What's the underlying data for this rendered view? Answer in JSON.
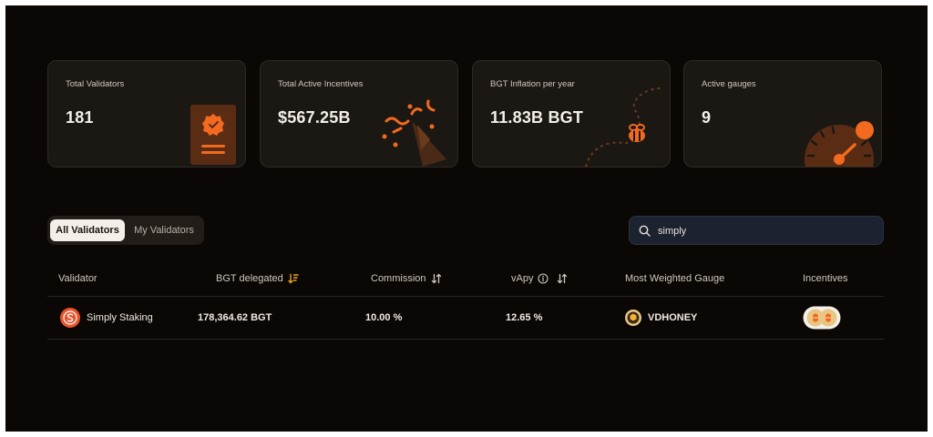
{
  "stats": [
    {
      "label": "Total Validators",
      "value": "181",
      "icon": "validator-badge-icon"
    },
    {
      "label": "Total Active Incentives",
      "value": "$567.25B",
      "icon": "confetti-icon"
    },
    {
      "label": "BGT Inflation per year",
      "value": "11.83B BGT",
      "icon": "bee-icon"
    },
    {
      "label": "Active gauges",
      "value": "9",
      "icon": "gauge-icon"
    }
  ],
  "tabs": {
    "all": "All Validators",
    "mine": "My Validators",
    "active": "All Validators"
  },
  "search": {
    "value": "simply",
    "icon": "search-icon"
  },
  "table": {
    "headers": {
      "validator": "Validator",
      "bgt_delegated": "BGT delegated",
      "commission": "Commission",
      "vapy": "vApy",
      "gauge": "Most Weighted Gauge",
      "incentives": "Incentives"
    },
    "rows": [
      {
        "validator": "Simply Staking",
        "bgt_delegated": "178,364.62 BGT",
        "commission": "10.00 %",
        "vapy": "12.65 %",
        "gauge": "VDHONEY"
      }
    ]
  },
  "colors": {
    "accent": "#f26a1f",
    "background": "#0b0704",
    "card": "#1b1713",
    "sort_active": "#e9a51c"
  }
}
